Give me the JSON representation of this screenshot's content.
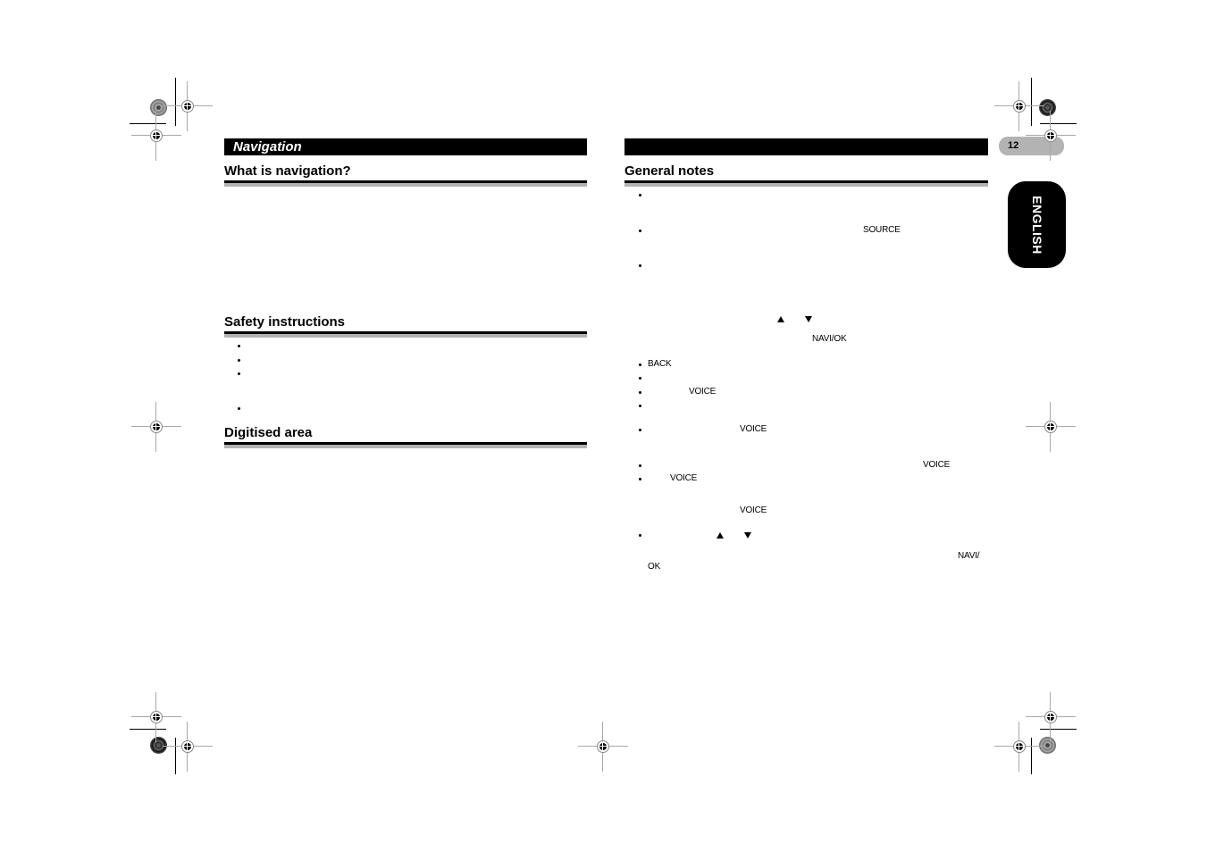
{
  "page": {
    "page_number": "12",
    "language_tab": "ENGLISH"
  },
  "left_column": {
    "section_title": "Navigation",
    "sections": [
      {
        "heading": "What is navigation?"
      },
      {
        "heading": "Safety instructions"
      },
      {
        "heading": "Digitised area"
      }
    ]
  },
  "right_column": {
    "section_title": "",
    "heading": "General notes",
    "keys": {
      "source": "SOURCE",
      "navi_ok": "NAVI/OK",
      "back": "BACK",
      "voice": "VOICE",
      "navi_split": "NAVI/",
      "ok_split": "OK"
    },
    "icons": {
      "up": "up-arrow-triangle",
      "down": "down-arrow-triangle"
    }
  }
}
